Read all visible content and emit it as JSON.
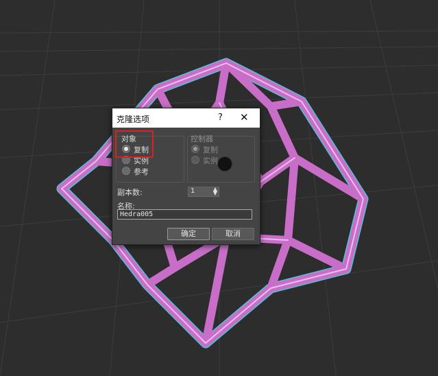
{
  "dialog": {
    "title": "克隆选项",
    "help_label": "?",
    "close_label": "✕",
    "object_group": {
      "label": "对象",
      "options": [
        {
          "label": "复制",
          "selected": true
        },
        {
          "label": "实例",
          "selected": false
        },
        {
          "label": "参考",
          "selected": false
        }
      ]
    },
    "controller_group": {
      "label": "控制器",
      "options": [
        {
          "label": "复制",
          "selected": true
        },
        {
          "label": "实例",
          "selected": false
        }
      ]
    },
    "copies_label": "副本数:",
    "copies_value": "1",
    "name_label": "名称:",
    "name_value": "Hedra005",
    "ok_label": "确定",
    "cancel_label": "取消"
  },
  "colors": {
    "viewport_bg": "#2d2d2d",
    "grid_line": "#3d3d3d",
    "tube": "#c86ec8",
    "selection": "#4fd8e8",
    "highlight": "#e02020"
  }
}
